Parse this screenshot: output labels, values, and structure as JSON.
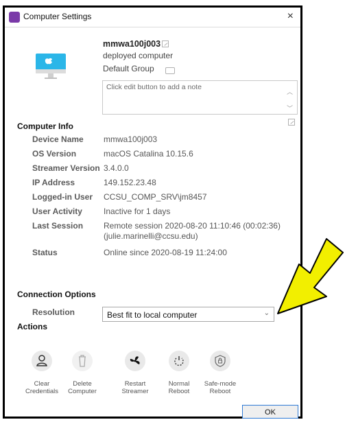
{
  "window": {
    "title": "Computer Settings",
    "close_glyph": "×"
  },
  "computer": {
    "name": "mmwa100j003",
    "type": "deployed computer",
    "group": "Default Group",
    "note_placeholder": "Click edit button to add a note"
  },
  "computer_info": {
    "heading": "Computer Info",
    "rows": [
      {
        "key": "Device Name",
        "value": "mmwa100j003"
      },
      {
        "key": "OS Version",
        "value": "macOS Catalina 10.15.6"
      },
      {
        "key": "Streamer Version",
        "value": "3.4.0.0"
      },
      {
        "key": "IP Address",
        "value": "149.152.23.48"
      },
      {
        "key": "Logged-in User",
        "value": "CCSU_COMP_SRV\\jm8457"
      },
      {
        "key": "User Activity",
        "value": "Inactive for 1 days"
      },
      {
        "key": "Last Session",
        "value": "Remote session 2020-08-20 11:10:46 (00:02:36)",
        "value2": "(julie.marinelli@ccsu.edu)"
      },
      {
        "key": "Status",
        "value": "Online since 2020-08-19 11:24:00"
      }
    ]
  },
  "connection_options": {
    "heading": "Connection Options",
    "resolution_label": "Resolution",
    "resolution_value": "Best fit to local computer"
  },
  "actions": {
    "heading": "Actions",
    "items": [
      {
        "line1": "Clear",
        "line2": "Credentials",
        "icon": "user-icon"
      },
      {
        "line1": "Delete",
        "line2": "Computer",
        "icon": "trash-icon"
      },
      {
        "line1": "Restart",
        "line2": "Streamer",
        "icon": "fan-icon"
      },
      {
        "line1": "Normal",
        "line2": "Reboot",
        "icon": "power-icon"
      },
      {
        "line1": "Safe-mode",
        "line2": "Reboot",
        "icon": "shield-icon"
      }
    ],
    "ok_label": "OK"
  },
  "colors": {
    "accent": "#2f7bd6",
    "highlight_arrow": "#f2ef00",
    "imac_screen": "#2bb6e8"
  }
}
